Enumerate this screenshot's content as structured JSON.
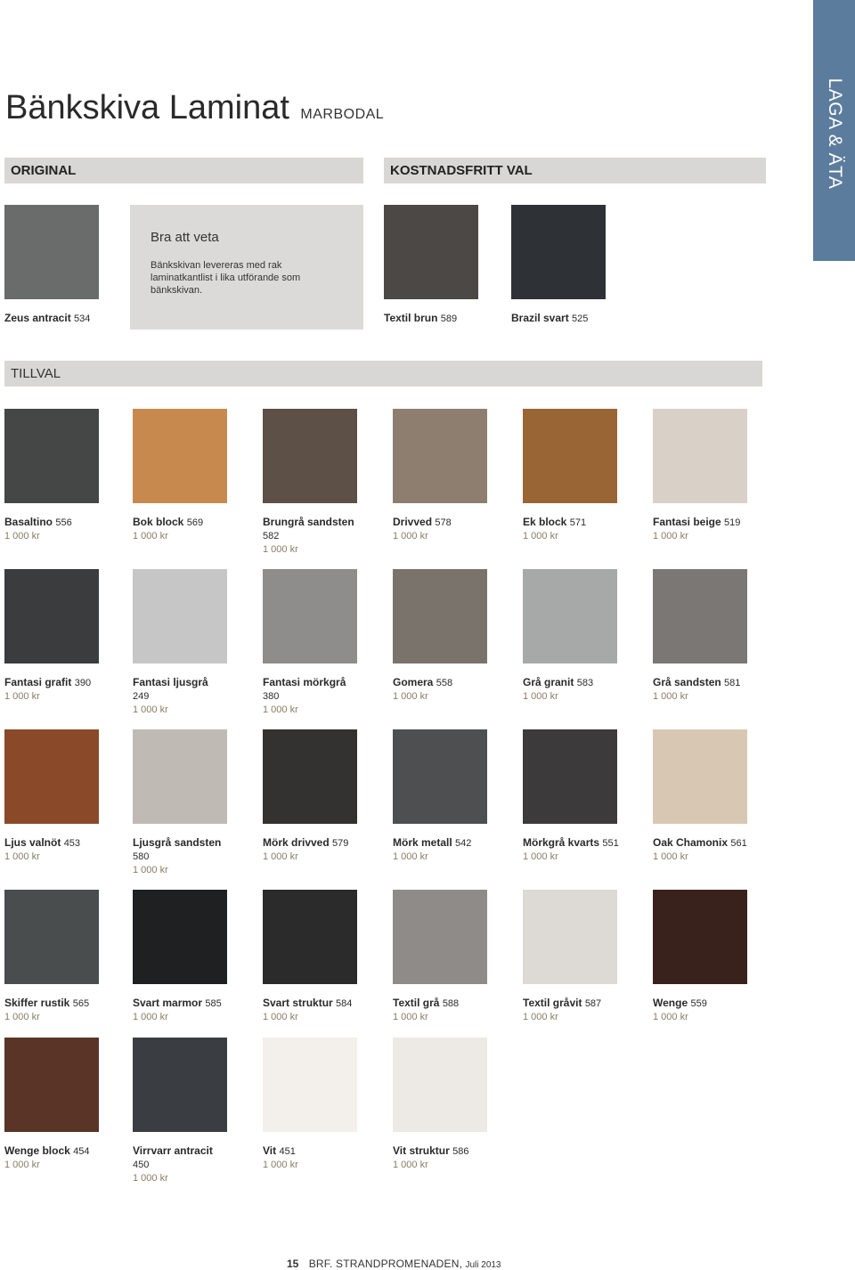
{
  "side_tab": "LAGA & ÄTA",
  "title": {
    "main": "Bänkskiva Laminat",
    "brand": "MARBODAL"
  },
  "sections": {
    "original": "ORIGINAL",
    "kostnadsfritt": "KOSTNADSFRITT VAL",
    "tillval": "TILLVAL"
  },
  "info": {
    "heading": "Bra att veta",
    "text": "Bänkskivan levereras med rak laminatkantlist i lika utförande som bänkskivan."
  },
  "original": {
    "name": "Zeus antracit",
    "code": "534",
    "color": "#6a6b6b"
  },
  "kostnadsfritt": [
    {
      "name": "Textil brun",
      "code": "589",
      "color": "#4c4845"
    },
    {
      "name": "Brazil svart",
      "code": "525",
      "color": "#2e3236"
    }
  ],
  "tillval": [
    {
      "name": "Basaltino",
      "code": "556",
      "price": "1 000 kr",
      "color": "#444745"
    },
    {
      "name": "Bok block",
      "code": "569",
      "price": "1 000 kr",
      "color": "#c8894e"
    },
    {
      "name": "Brungrå sandsten",
      "code": "582",
      "price": "1 000 kr",
      "color": "#5d5046"
    },
    {
      "name": "Drivved",
      "code": "578",
      "price": "1 000 kr",
      "color": "#8d7e70"
    },
    {
      "name": "Ek block",
      "code": "571",
      "price": "1 000 kr",
      "color": "#9a6535"
    },
    {
      "name": "Fantasi beige",
      "code": "519",
      "price": "1 000 kr",
      "color": "#d9d0c7"
    },
    {
      "name": "Fantasi grafit",
      "code": "390",
      "price": "1 000 kr",
      "color": "#3b3c3e"
    },
    {
      "name": "Fantasi ljusgrå",
      "code": "249",
      "price": "1 000 kr",
      "color": "#c6c6c6"
    },
    {
      "name": "Fantasi mörkgrå",
      "code": "380",
      "price": "1 000 kr",
      "color": "#8e8d8b"
    },
    {
      "name": "Gomera",
      "code": "558",
      "price": "1 000 kr",
      "color": "#7a736c"
    },
    {
      "name": "Grå granit",
      "code": "583",
      "price": "1 000 kr",
      "color": "#a7a8a8"
    },
    {
      "name": "Grå sandsten",
      "code": "581",
      "price": "1 000 kr",
      "color": "#7b7775"
    },
    {
      "name": "Ljus valnöt",
      "code": "453",
      "price": "1 000 kr",
      "color": "#8a4a2a"
    },
    {
      "name": "Ljusgrå sandsten",
      "code": "580",
      "price": "1 000 kr",
      "color": "#bfbab4"
    },
    {
      "name": "Mörk drivved",
      "code": "579",
      "price": "1 000 kr",
      "color": "#343231"
    },
    {
      "name": "Mörk metall",
      "code": "542",
      "price": "1 000 kr",
      "color": "#4e4f50"
    },
    {
      "name": "Mörkgrå kvarts",
      "code": "551",
      "price": "1 000 kr",
      "color": "#3c3a3a"
    },
    {
      "name": "Oak Chamonix",
      "code": "561",
      "price": "1 000 kr",
      "color": "#d8c8b3"
    },
    {
      "name": "Skiffer rustik",
      "code": "565",
      "price": "1 000 kr",
      "color": "#4a4d4e"
    },
    {
      "name": "Svart marmor",
      "code": "585",
      "price": "1 000 kr",
      "color": "#1f2022"
    },
    {
      "name": "Svart struktur",
      "code": "584",
      "price": "1 000 kr",
      "color": "#2b2b2c"
    },
    {
      "name": "Textil grå",
      "code": "588",
      "price": "1 000 kr",
      "color": "#8f8b88"
    },
    {
      "name": "Textil gråvit",
      "code": "587",
      "price": "1 000 kr",
      "color": "#ddd9d5"
    },
    {
      "name": "Wenge",
      "code": "559",
      "price": "1 000 kr",
      "color": "#3a221c"
    },
    {
      "name": "Wenge block",
      "code": "454",
      "price": "1 000 kr",
      "color": "#5a3427"
    },
    {
      "name": "Virrvarr antracit",
      "code": "450",
      "price": "1 000 kr",
      "color": "#3a3d41"
    },
    {
      "name": "Vit",
      "code": "451",
      "price": "1 000 kr",
      "color": "#f3efea"
    },
    {
      "name": "Vit struktur",
      "code": "586",
      "price": "1 000 kr",
      "color": "#ede9e4"
    }
  ],
  "footer": {
    "page": "15",
    "publication": "BRF. STRANDPROMENADEN,",
    "date": "Juli 2013"
  }
}
